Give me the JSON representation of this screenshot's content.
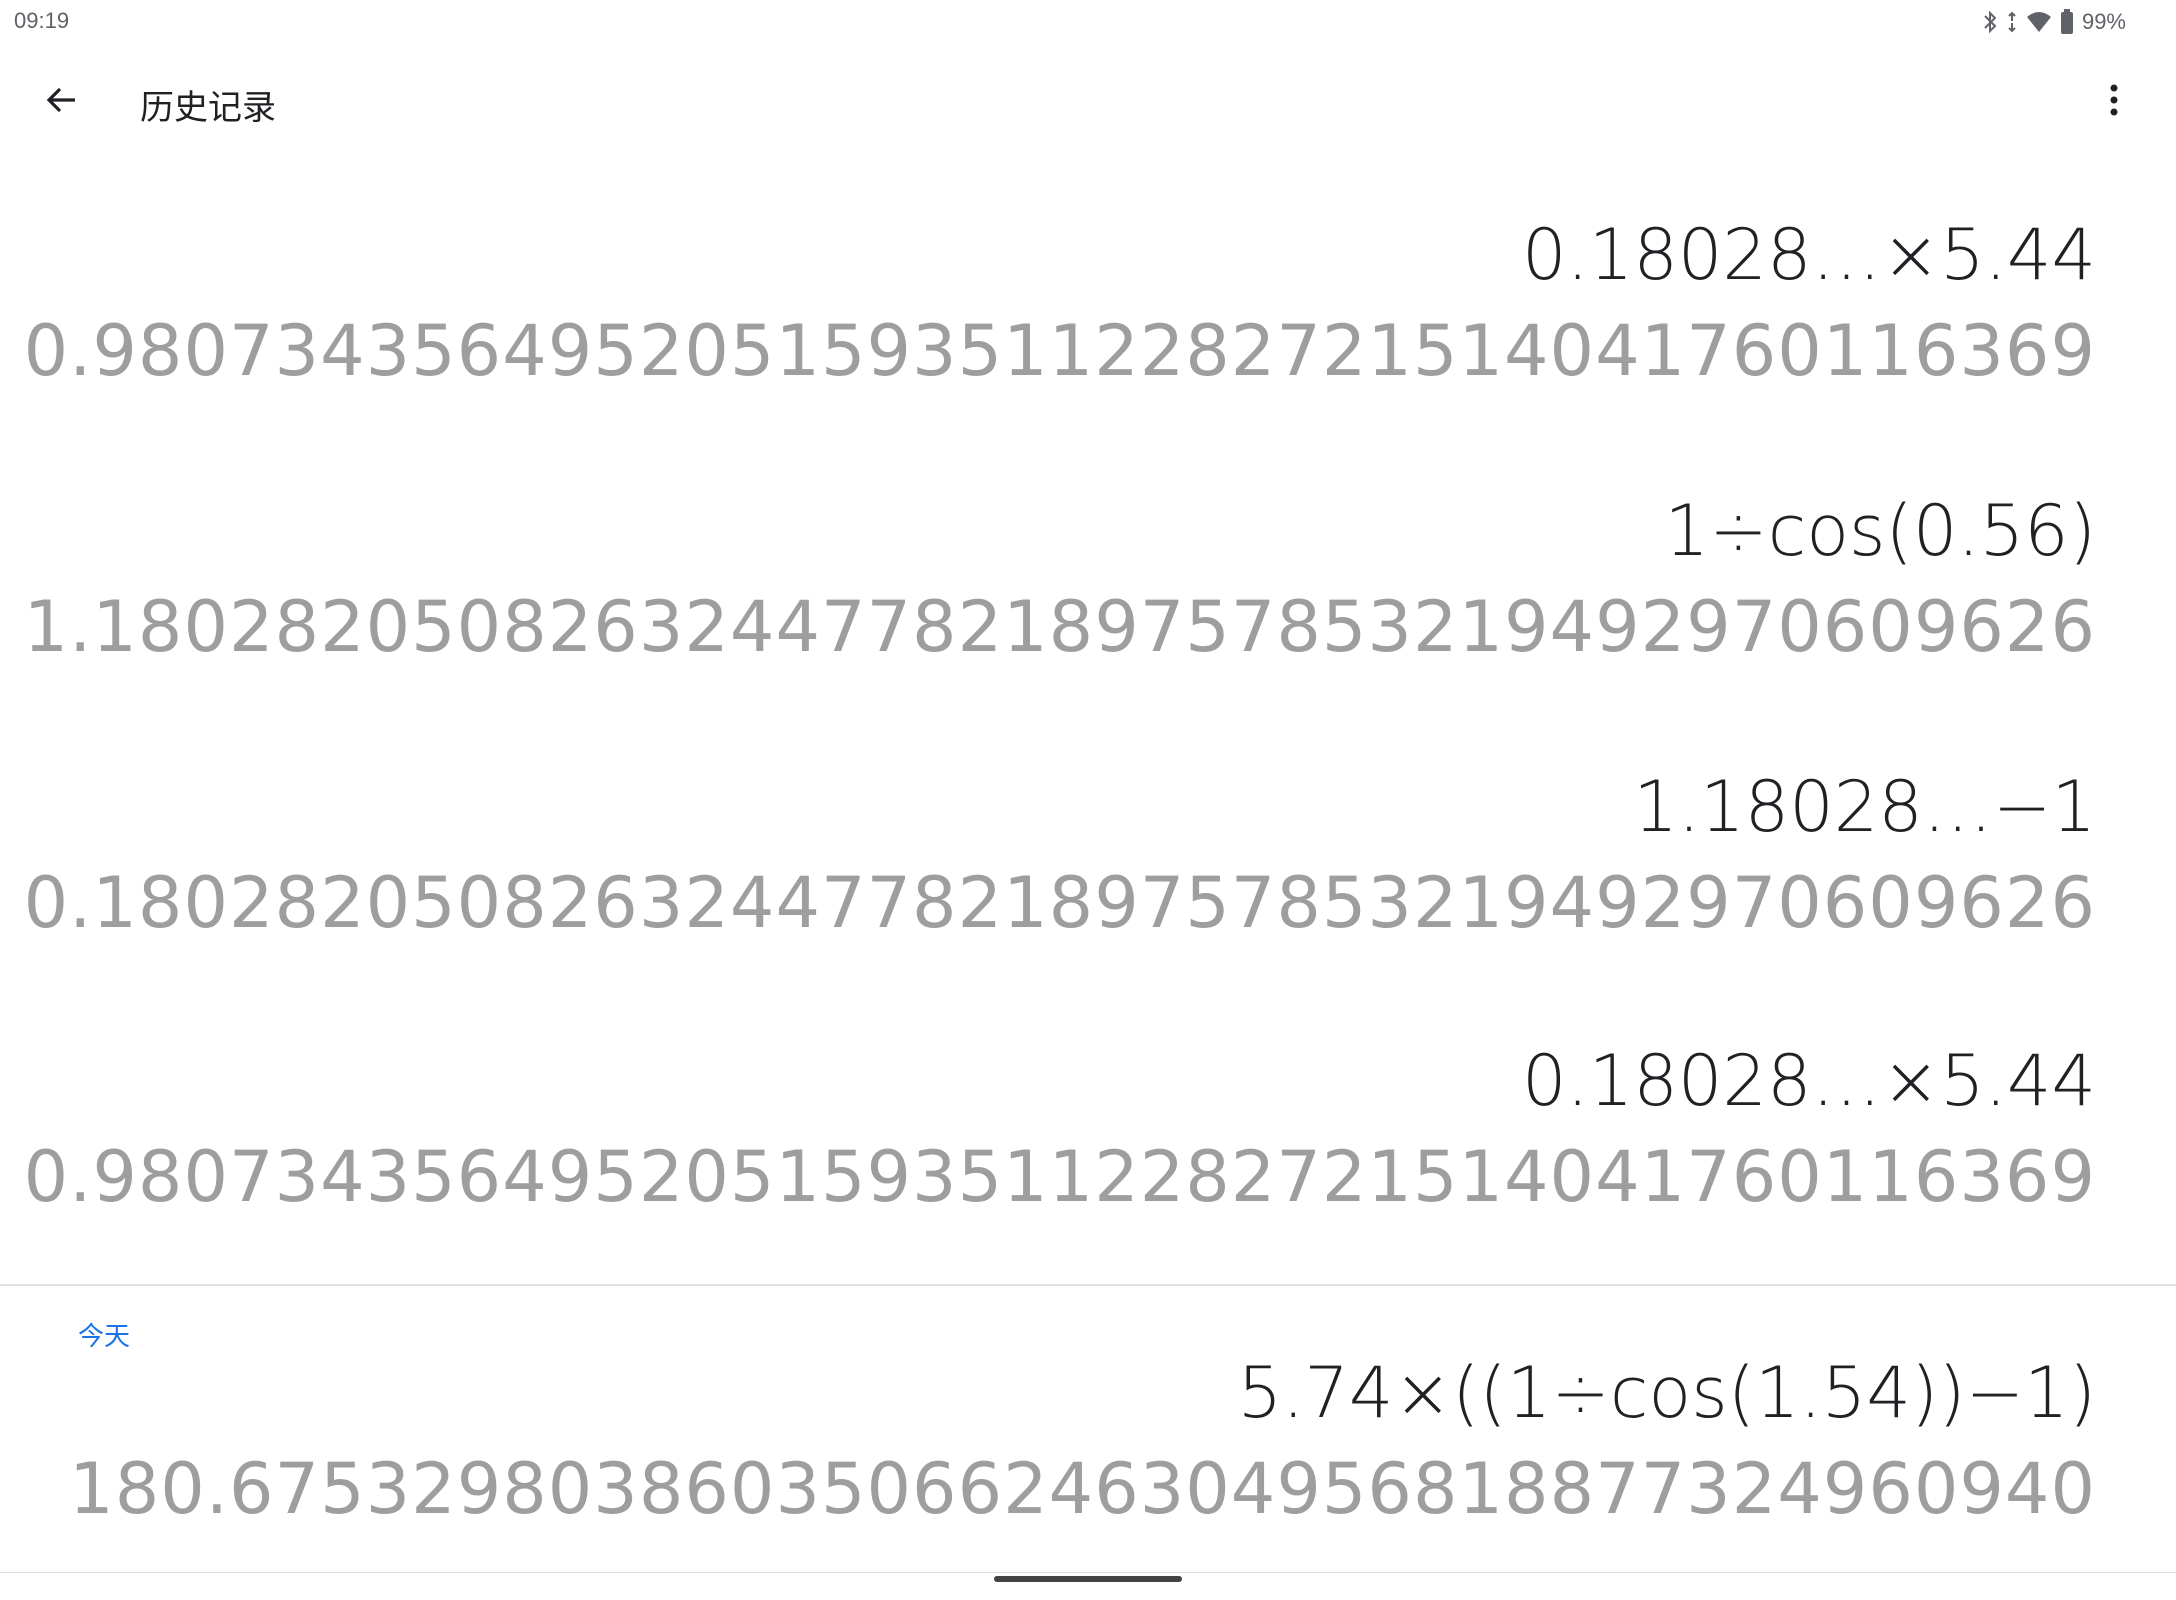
{
  "status_bar": {
    "time": "09:19",
    "battery": "99%",
    "icons": [
      "bluetooth-icon",
      "data-arrows-icon",
      "wifi-icon",
      "battery-icon"
    ]
  },
  "app_bar": {
    "title": "历史记录",
    "back_icon": "arrow-back-icon",
    "menu_icon": "more-vert-icon"
  },
  "history": {
    "older": [
      {
        "expression": "0.18028…×5.44",
        "result": "0.98073435649520515935112282721514041760116369"
      },
      {
        "expression": "1÷cos(0.56)",
        "result": "1.18028205082632447782189757853219492970609626"
      },
      {
        "expression": "1.18028…−1",
        "result": "0.18028205082632447782189757853219492970609626"
      },
      {
        "expression": "0.18028…×5.44",
        "result": "0.98073435649520515935112282721514041760116369"
      }
    ],
    "today_label": "今天",
    "today": [
      {
        "expression": "5.74×((1÷cos(1.54))−1)",
        "result": "180.67532980386035066246304956818877324960940"
      }
    ]
  },
  "colors": {
    "expression": "#202124",
    "result": "#9e9e9e",
    "accent": "#1a73e8",
    "divider": "#e0e0e0"
  }
}
